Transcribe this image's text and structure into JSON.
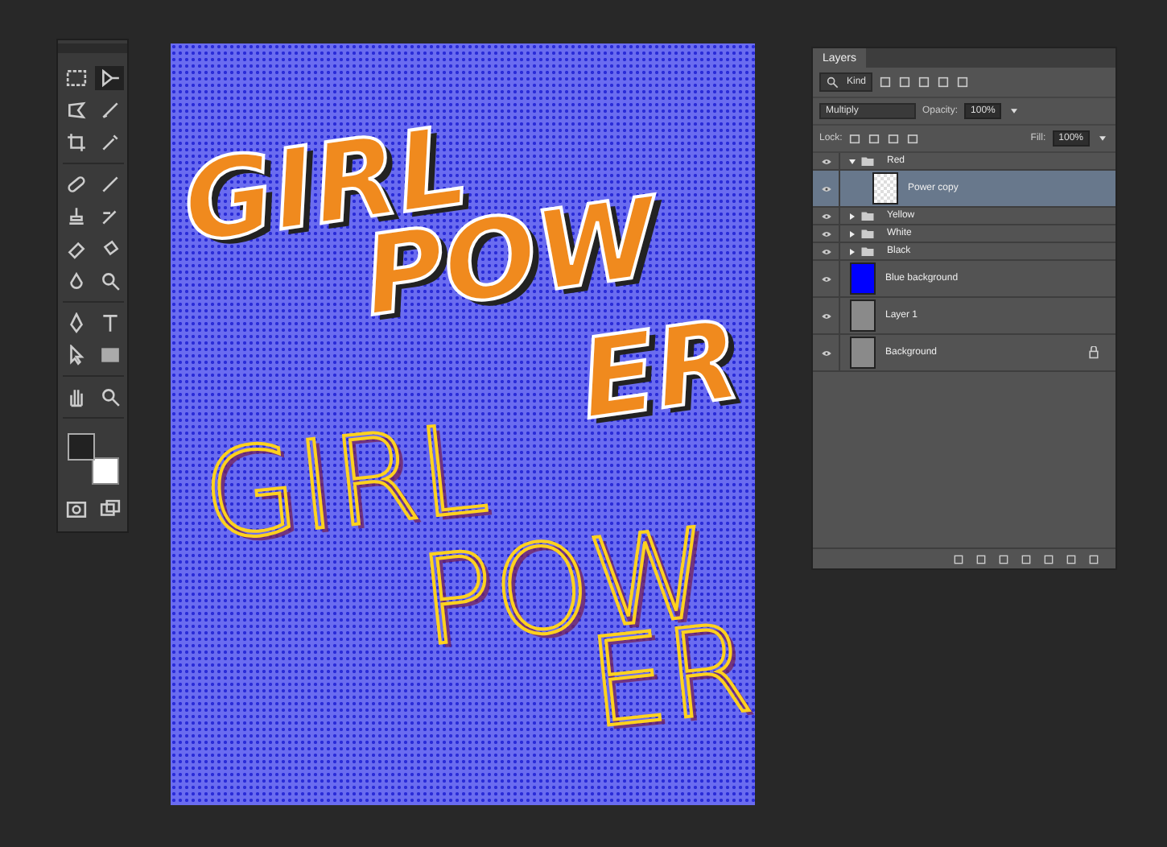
{
  "artwork": {
    "bold_words": [
      "GIRL",
      "POW",
      "ER"
    ],
    "outline_words": [
      "GIRL",
      "POW",
      "ER"
    ]
  },
  "layers_panel": {
    "tab": "Layers",
    "filter": "Kind",
    "blend_mode": "Multiply",
    "opacity_label": "Opacity:",
    "opacity": "100%",
    "lock_label": "Lock:",
    "fill_label": "Fill:",
    "fill": "100%",
    "layers": [
      {
        "kind": "group",
        "name": "Red",
        "visible": true,
        "expanded": true,
        "selected": false,
        "locked": false,
        "children": [
          {
            "kind": "layer",
            "name": "Power copy",
            "visible": true,
            "selected": true,
            "locked": false,
            "thumbnail": {
              "kind": "transparent"
            }
          }
        ]
      },
      {
        "kind": "group",
        "name": "Yellow",
        "visible": true,
        "expanded": false,
        "selected": false,
        "locked": false
      },
      {
        "kind": "group",
        "name": "White",
        "visible": true,
        "expanded": false,
        "selected": false,
        "locked": false
      },
      {
        "kind": "group",
        "name": "Black",
        "visible": true,
        "expanded": false,
        "selected": false,
        "locked": false
      },
      {
        "kind": "layer",
        "name": "Blue background",
        "visible": true,
        "selected": false,
        "locked": false,
        "thumbnail": {
          "kind": "blue"
        }
      },
      {
        "kind": "layer",
        "name": "Layer 1",
        "visible": true,
        "selected": false,
        "locked": false,
        "thumbnail": {
          "kind": "grey"
        }
      },
      {
        "kind": "layer",
        "name": "Background",
        "visible": true,
        "selected": false,
        "locked": true,
        "thumbnail": {
          "kind": "grey"
        }
      }
    ]
  }
}
